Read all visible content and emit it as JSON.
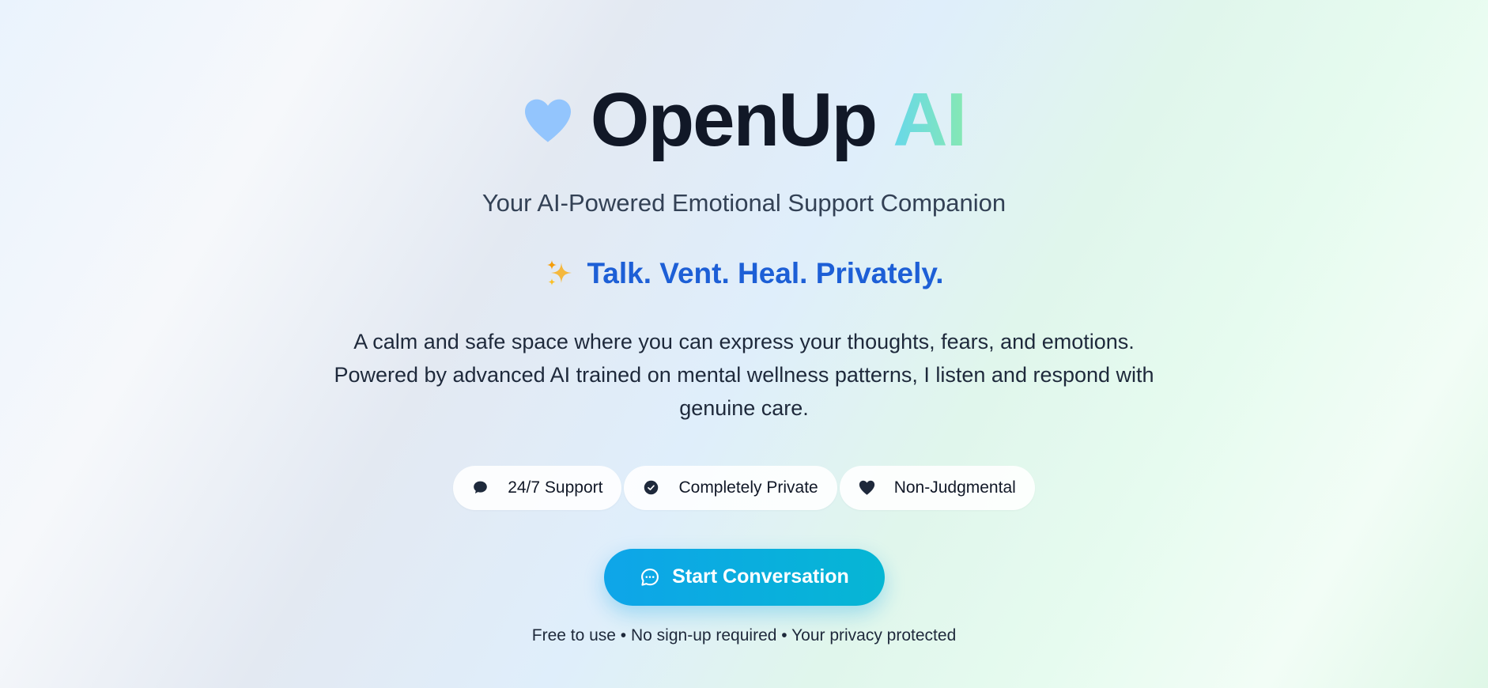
{
  "brand": {
    "title_main": "OpenUp",
    "title_accent": "AI",
    "logo_icon": "heart-icon",
    "logo_color": "#93c5fd",
    "accent_gradient": [
      "#67d8ea",
      "#86e8b3"
    ]
  },
  "hero": {
    "subtitle": "Your AI-Powered Emotional Support Companion",
    "tagline_icon": "sparkles-icon",
    "tagline": "Talk. Vent. Heal. Privately.",
    "tagline_color": "#1d5fd6",
    "description_line1": "A calm and safe space where you can express your thoughts, fears, and emotions.",
    "description_line2": "Powered by advanced AI trained on mental wellness patterns, I listen and respond with",
    "description_line3": "genuine care."
  },
  "features": [
    {
      "icon": "chat-bubble-icon",
      "label": "24/7 Support"
    },
    {
      "icon": "check-badge-icon",
      "label": "Completely Private"
    },
    {
      "icon": "heart-icon",
      "label": "Non-Judgmental"
    }
  ],
  "cta": {
    "icon": "chat-icon",
    "label": "Start Conversation",
    "gradient": [
      "#0ea5e9",
      "#06b6d4"
    ]
  },
  "footnote": "Free to use • No sign-up required • Your privacy protected"
}
